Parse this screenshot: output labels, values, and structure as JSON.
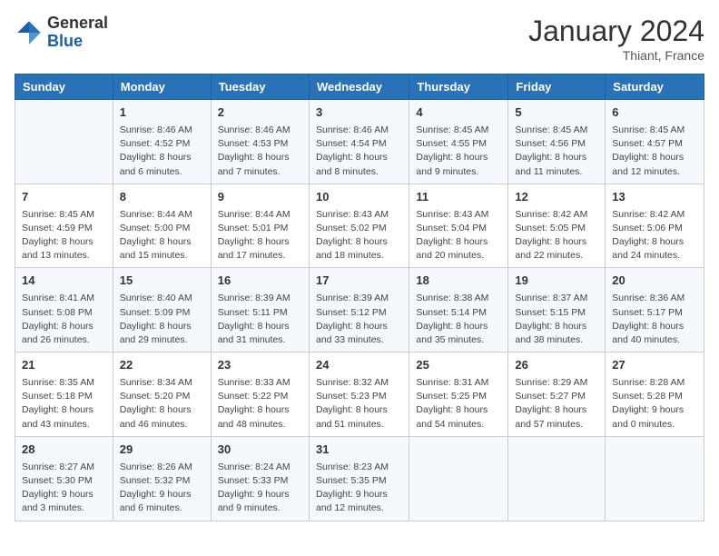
{
  "header": {
    "logo_general": "General",
    "logo_blue": "Blue",
    "month_year": "January 2024",
    "location": "Thiant, France"
  },
  "weekdays": [
    "Sunday",
    "Monday",
    "Tuesday",
    "Wednesday",
    "Thursday",
    "Friday",
    "Saturday"
  ],
  "weeks": [
    [
      {
        "day": "",
        "content": ""
      },
      {
        "day": "1",
        "content": "Sunrise: 8:46 AM\nSunset: 4:52 PM\nDaylight: 8 hours\nand 6 minutes."
      },
      {
        "day": "2",
        "content": "Sunrise: 8:46 AM\nSunset: 4:53 PM\nDaylight: 8 hours\nand 7 minutes."
      },
      {
        "day": "3",
        "content": "Sunrise: 8:46 AM\nSunset: 4:54 PM\nDaylight: 8 hours\nand 8 minutes."
      },
      {
        "day": "4",
        "content": "Sunrise: 8:45 AM\nSunset: 4:55 PM\nDaylight: 8 hours\nand 9 minutes."
      },
      {
        "day": "5",
        "content": "Sunrise: 8:45 AM\nSunset: 4:56 PM\nDaylight: 8 hours\nand 11 minutes."
      },
      {
        "day": "6",
        "content": "Sunrise: 8:45 AM\nSunset: 4:57 PM\nDaylight: 8 hours\nand 12 minutes."
      }
    ],
    [
      {
        "day": "7",
        "content": "Sunrise: 8:45 AM\nSunset: 4:59 PM\nDaylight: 8 hours\nand 13 minutes."
      },
      {
        "day": "8",
        "content": "Sunrise: 8:44 AM\nSunset: 5:00 PM\nDaylight: 8 hours\nand 15 minutes."
      },
      {
        "day": "9",
        "content": "Sunrise: 8:44 AM\nSunset: 5:01 PM\nDaylight: 8 hours\nand 17 minutes."
      },
      {
        "day": "10",
        "content": "Sunrise: 8:43 AM\nSunset: 5:02 PM\nDaylight: 8 hours\nand 18 minutes."
      },
      {
        "day": "11",
        "content": "Sunrise: 8:43 AM\nSunset: 5:04 PM\nDaylight: 8 hours\nand 20 minutes."
      },
      {
        "day": "12",
        "content": "Sunrise: 8:42 AM\nSunset: 5:05 PM\nDaylight: 8 hours\nand 22 minutes."
      },
      {
        "day": "13",
        "content": "Sunrise: 8:42 AM\nSunset: 5:06 PM\nDaylight: 8 hours\nand 24 minutes."
      }
    ],
    [
      {
        "day": "14",
        "content": "Sunrise: 8:41 AM\nSunset: 5:08 PM\nDaylight: 8 hours\nand 26 minutes."
      },
      {
        "day": "15",
        "content": "Sunrise: 8:40 AM\nSunset: 5:09 PM\nDaylight: 8 hours\nand 29 minutes."
      },
      {
        "day": "16",
        "content": "Sunrise: 8:39 AM\nSunset: 5:11 PM\nDaylight: 8 hours\nand 31 minutes."
      },
      {
        "day": "17",
        "content": "Sunrise: 8:39 AM\nSunset: 5:12 PM\nDaylight: 8 hours\nand 33 minutes."
      },
      {
        "day": "18",
        "content": "Sunrise: 8:38 AM\nSunset: 5:14 PM\nDaylight: 8 hours\nand 35 minutes."
      },
      {
        "day": "19",
        "content": "Sunrise: 8:37 AM\nSunset: 5:15 PM\nDaylight: 8 hours\nand 38 minutes."
      },
      {
        "day": "20",
        "content": "Sunrise: 8:36 AM\nSunset: 5:17 PM\nDaylight: 8 hours\nand 40 minutes."
      }
    ],
    [
      {
        "day": "21",
        "content": "Sunrise: 8:35 AM\nSunset: 5:18 PM\nDaylight: 8 hours\nand 43 minutes."
      },
      {
        "day": "22",
        "content": "Sunrise: 8:34 AM\nSunset: 5:20 PM\nDaylight: 8 hours\nand 46 minutes."
      },
      {
        "day": "23",
        "content": "Sunrise: 8:33 AM\nSunset: 5:22 PM\nDaylight: 8 hours\nand 48 minutes."
      },
      {
        "day": "24",
        "content": "Sunrise: 8:32 AM\nSunset: 5:23 PM\nDaylight: 8 hours\nand 51 minutes."
      },
      {
        "day": "25",
        "content": "Sunrise: 8:31 AM\nSunset: 5:25 PM\nDaylight: 8 hours\nand 54 minutes."
      },
      {
        "day": "26",
        "content": "Sunrise: 8:29 AM\nSunset: 5:27 PM\nDaylight: 8 hours\nand 57 minutes."
      },
      {
        "day": "27",
        "content": "Sunrise: 8:28 AM\nSunset: 5:28 PM\nDaylight: 9 hours\nand 0 minutes."
      }
    ],
    [
      {
        "day": "28",
        "content": "Sunrise: 8:27 AM\nSunset: 5:30 PM\nDaylight: 9 hours\nand 3 minutes."
      },
      {
        "day": "29",
        "content": "Sunrise: 8:26 AM\nSunset: 5:32 PM\nDaylight: 9 hours\nand 6 minutes."
      },
      {
        "day": "30",
        "content": "Sunrise: 8:24 AM\nSunset: 5:33 PM\nDaylight: 9 hours\nand 9 minutes."
      },
      {
        "day": "31",
        "content": "Sunrise: 8:23 AM\nSunset: 5:35 PM\nDaylight: 9 hours\nand 12 minutes."
      },
      {
        "day": "",
        "content": ""
      },
      {
        "day": "",
        "content": ""
      },
      {
        "day": "",
        "content": ""
      }
    ]
  ]
}
